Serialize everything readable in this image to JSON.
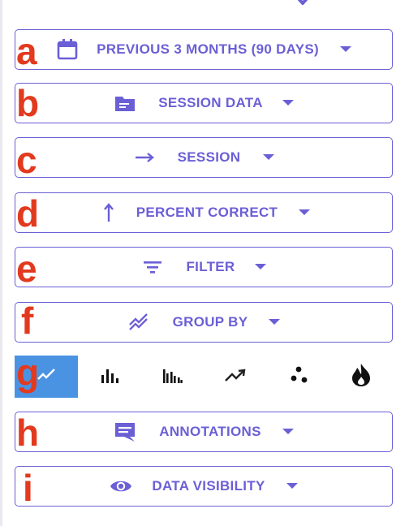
{
  "controls": [
    {
      "key": "a",
      "label": "PREVIOUS 3 MONTHS (90 DAYS)",
      "icon": "calendar-icon"
    },
    {
      "key": "b",
      "label": "SESSION DATA",
      "icon": "folder-icon"
    },
    {
      "key": "c",
      "label": "SESSION",
      "icon": "arrow-right-icon"
    },
    {
      "key": "d",
      "label": "PERCENT CORRECT",
      "icon": "arrow-up-icon"
    },
    {
      "key": "e",
      "label": "FILTER",
      "icon": "filter-icon"
    },
    {
      "key": "f",
      "label": "GROUP BY",
      "icon": "multiline-icon"
    },
    {
      "key": "h",
      "label": "ANNOTATIONS",
      "icon": "comment-icon"
    },
    {
      "key": "i",
      "label": "DATA VISIBILITY",
      "icon": "eye-icon"
    }
  ],
  "letters": {
    "a": "a",
    "b": "b",
    "c": "c",
    "d": "d",
    "e": "e",
    "f": "f",
    "g": "g",
    "h": "h",
    "i": "i"
  },
  "chart_types": [
    {
      "icon": "line-chart-icon",
      "selected": true
    },
    {
      "icon": "bar-chart-icon",
      "selected": false
    },
    {
      "icon": "grouped-bar-chart-icon",
      "selected": false
    },
    {
      "icon": "trend-chart-icon",
      "selected": false
    },
    {
      "icon": "scatter-chart-icon",
      "selected": false
    },
    {
      "icon": "heat-chart-icon",
      "selected": false
    }
  ],
  "colors": {
    "accent": "#6b5fd6",
    "selected_bg": "#4a93e3",
    "annotation": "#e23a1f"
  }
}
